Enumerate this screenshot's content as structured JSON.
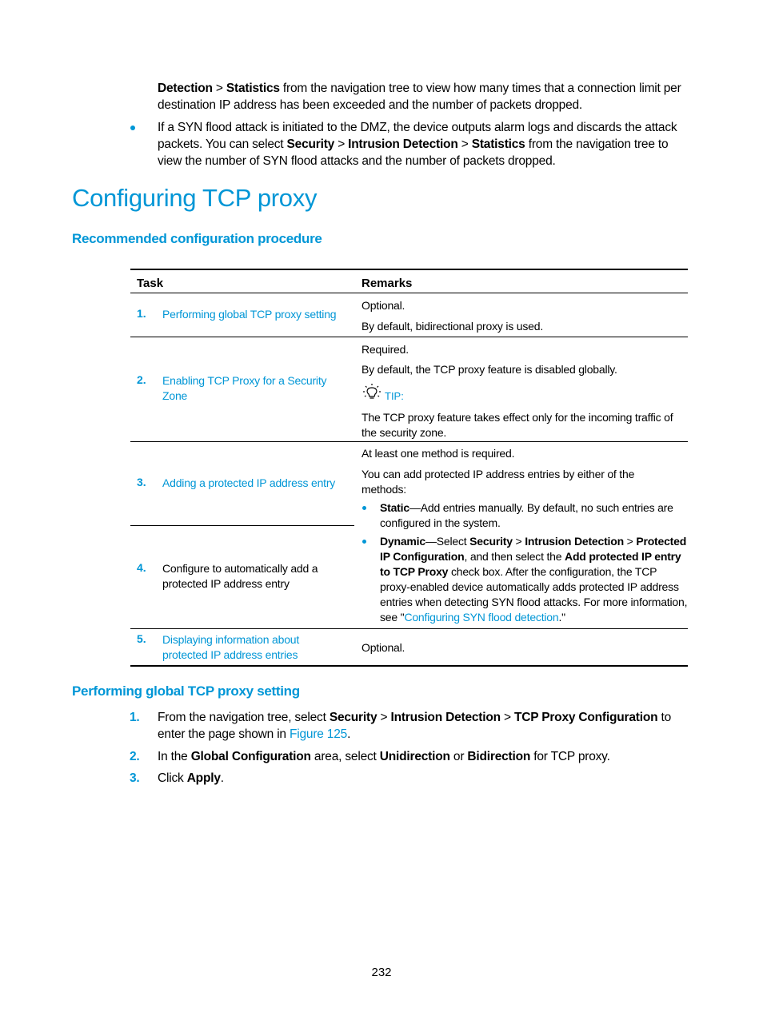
{
  "intro": {
    "para1": {
      "b1": "Detection",
      "sep": " > ",
      "b2": "Statistics",
      "rest": " from the navigation tree to view how many times that a connection limit per destination IP address has been exceeded and the number of packets dropped."
    },
    "bullet1": {
      "t1": "If a SYN flood attack is initiated to the DMZ, the device outputs alarm logs and discards the attack packets. You can select ",
      "b1": "Security",
      "sep1": " > ",
      "b2": "Intrusion Detection",
      "sep2": " > ",
      "b3": "Statistics",
      "t2": " from the navigation tree to view the number of SYN flood attacks and the number of packets dropped."
    }
  },
  "section_title": "Configuring TCP proxy",
  "subsection1_title": "Recommended configuration procedure",
  "table": {
    "headers": [
      "Task",
      "Remarks"
    ],
    "rows": [
      {
        "num": "1.",
        "task": "Performing global TCP proxy setting",
        "task_is_link": true,
        "remarks": [
          "Optional.",
          "By default, bidirectional proxy is used."
        ]
      },
      {
        "num": "2.",
        "task": "Enabling TCP Proxy for a Security Zone",
        "task_is_link": true,
        "remarks": [
          "Required.",
          "By default, the TCP proxy feature is disabled globally."
        ],
        "tip_label": "TIP:",
        "tip_text": "The TCP proxy feature takes effect only for the incoming traffic of the security zone."
      },
      {
        "num": "3.",
        "task": "Adding a protected IP address entry",
        "task_is_link": true
      },
      {
        "num": "4.",
        "task": "Configure to automatically add a protected IP address entry",
        "task_is_link": false
      },
      {
        "num": "5.",
        "task": "Displaying information about protected IP address entries",
        "task_is_link": true,
        "remarks": [
          "Optional."
        ]
      }
    ],
    "shared_remarks_3_4": {
      "line1": "At least one method is required.",
      "line2": "You can add protected IP address entries by either of the methods:",
      "static": {
        "b": "Static",
        "t": "—Add entries manually. By default, no such entries are configured in the system."
      },
      "dynamic": {
        "b1": "Dynamic",
        "t1": "—Select ",
        "b2": "Security",
        "s1": " > ",
        "b3": "Intrusion Detection",
        "s2": " > ",
        "b4": "Protected IP Configuration",
        "t2": ", and then select the ",
        "b5": "Add protected IP entry to TCP Proxy",
        "t3": " check box. After the configuration, the TCP proxy-enabled device automatically adds protected IP address entries when detecting SYN flood attacks. For more information, see \"",
        "link": "Configuring SYN flood detection",
        "t4": ".\""
      }
    }
  },
  "subsection2_title": "Performing global TCP proxy setting",
  "steps": [
    {
      "num": "1.",
      "t1": "From the navigation tree, select ",
      "b1": "Security",
      "s1": " > ",
      "b2": "Intrusion Detection",
      "s2": " > ",
      "b3": "TCP Proxy Configuration",
      "t2": " to enter the page shown in ",
      "link": "Figure 125",
      "t3": "."
    },
    {
      "num": "2.",
      "t1": "In the ",
      "b1": "Global Configuration",
      "t2": " area, select ",
      "b2": "Unidirection",
      "t3": " or ",
      "b3": "Bidirection",
      "t4": " for TCP proxy."
    },
    {
      "num": "3.",
      "t1": "Click ",
      "b1": "Apply",
      "t2": "."
    }
  ],
  "page_number": "232",
  "colors": {
    "accent": "#0096d6",
    "text": "#000000"
  }
}
